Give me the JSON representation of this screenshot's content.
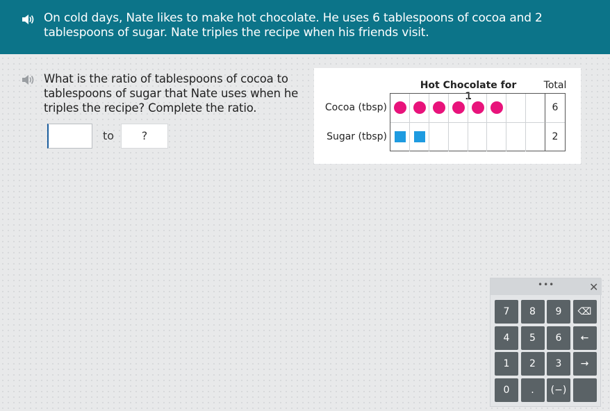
{
  "banner": {
    "text": "On cold days, Nate likes to make hot chocolate. He uses 6 tablespoons of cocoa and 2 tablespoons of sugar. Nate triples the recipe when his friends visit."
  },
  "question": {
    "text": "What is the ratio of tablespoons of cocoa to tablespoons of sugar that Nate uses when he triples the recipe? Complete the ratio.",
    "answer_value": "",
    "to_label": "to",
    "second_box": "?"
  },
  "table": {
    "title": "Hot Chocolate for 1",
    "total_header": "Total",
    "rows": [
      {
        "label": "Cocoa (tbsp)",
        "count": 6,
        "shape": "circle",
        "color": "#e8137b",
        "total": "6"
      },
      {
        "label": "Sugar (tbsp)",
        "count": 2,
        "shape": "square",
        "color": "#1e9be0",
        "total": "2"
      }
    ],
    "columns": 8
  },
  "keypad": {
    "dots": "•••",
    "close": "✕",
    "keys": [
      [
        "7",
        "8",
        "9",
        "⌫"
      ],
      [
        "4",
        "5",
        "6",
        "←"
      ],
      [
        "1",
        "2",
        "3",
        "→"
      ],
      [
        "0",
        ".",
        "(−)",
        ""
      ]
    ]
  },
  "colors": {
    "banner": "#0c7489",
    "key": "#5a6266"
  }
}
